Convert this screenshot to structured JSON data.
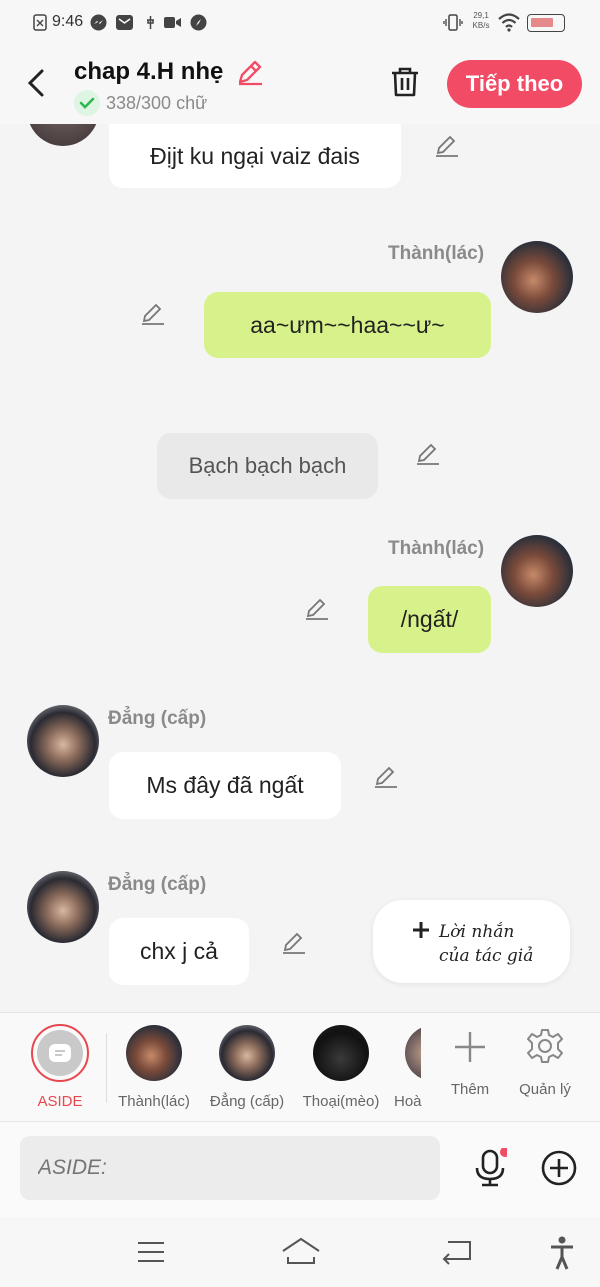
{
  "status": {
    "time": "9:46",
    "net_speed_top": "29,1",
    "net_speed_unit": "KB/s"
  },
  "header": {
    "title": "chap 4.H nhẹ",
    "word_count": "338/300 chữ",
    "next_label": "Tiếp theo"
  },
  "messages": [
    {
      "text": "Địjt ku ngại vaiz đais"
    },
    {
      "sender": "Thành(lác)",
      "text": "aa~ưm~~haa~~ư~"
    },
    {
      "text": "Bạch bạch bạch"
    },
    {
      "sender": "Thành(lác)",
      "text": "/ngất/"
    },
    {
      "sender": "Đẳng (cấp)",
      "text": "Ms đây đã ngất"
    },
    {
      "sender": "Đẳng (cấp)",
      "text": "chx j cả"
    }
  ],
  "author_note": {
    "line1": "Lời nhắn",
    "line2": "của tác giả"
  },
  "characters": [
    {
      "label": "ASIDE"
    },
    {
      "label": "Thành(lác)"
    },
    {
      "label": "Đẳng (cấp)"
    },
    {
      "label": "Thoại(mèo)"
    },
    {
      "label": "Hoà"
    },
    {
      "label": "Thêm"
    },
    {
      "label": "Quản lý"
    }
  ],
  "input": {
    "placeholder": "ASIDE:"
  },
  "colors": {
    "accent": "#f24b66",
    "green_bubble": "#d7f28a",
    "aside_ring": "#e8474f"
  }
}
